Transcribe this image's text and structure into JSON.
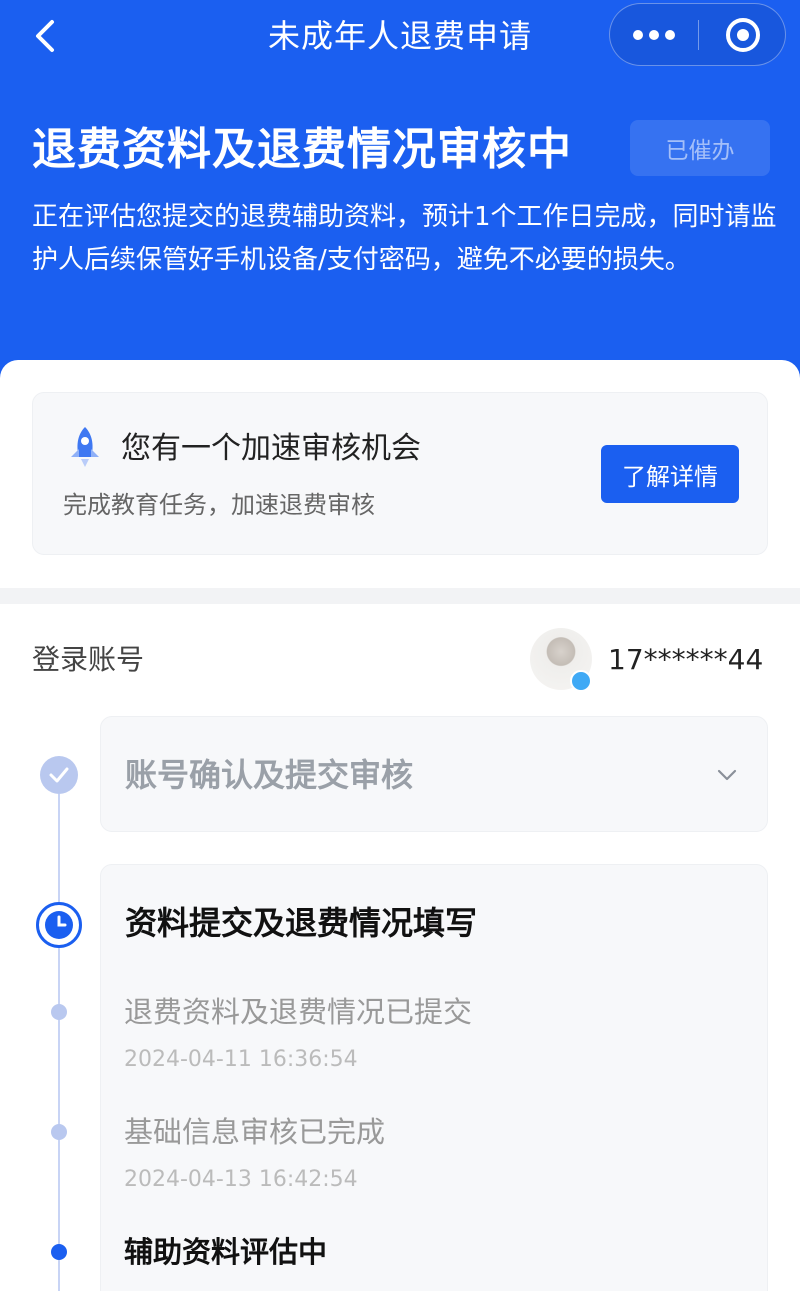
{
  "nav": {
    "title": "未成年人退费申请",
    "back_icon": "chevron-left-icon",
    "more_icon": "more-dots-icon",
    "close_icon": "target-circle-icon"
  },
  "status": {
    "title": "退费资料及退费情况审核中",
    "urged_label": "已催办",
    "description": "正在评估您提交的退费辅助资料，预计1个工作日完成，同时请监护人后续保管好手机设备/支付密码，避免不必要的损失。"
  },
  "speedup": {
    "icon": "rocket-icon",
    "title": "您有一个加速审核机会",
    "subtitle": "完成教育任务，加速退费审核",
    "button_label": "了解详情"
  },
  "account": {
    "label": "登录账号",
    "number": "17******44"
  },
  "steps": [
    {
      "title": "账号确认及提交审核",
      "state": "done"
    },
    {
      "title": "资料提交及退费情况填写",
      "state": "in-progress",
      "items": [
        {
          "title": "退费资料及退费情况已提交",
          "time": "2024-04-11 16:36:54"
        },
        {
          "title": "基础信息审核已完成",
          "time": "2024-04-13 16:42:54"
        },
        {
          "title": "辅助资料评估中",
          "time": ""
        }
      ]
    }
  ],
  "colors": {
    "brand_blue": "#1b5ff0",
    "timeline_inactive": "#b9c8ef"
  }
}
